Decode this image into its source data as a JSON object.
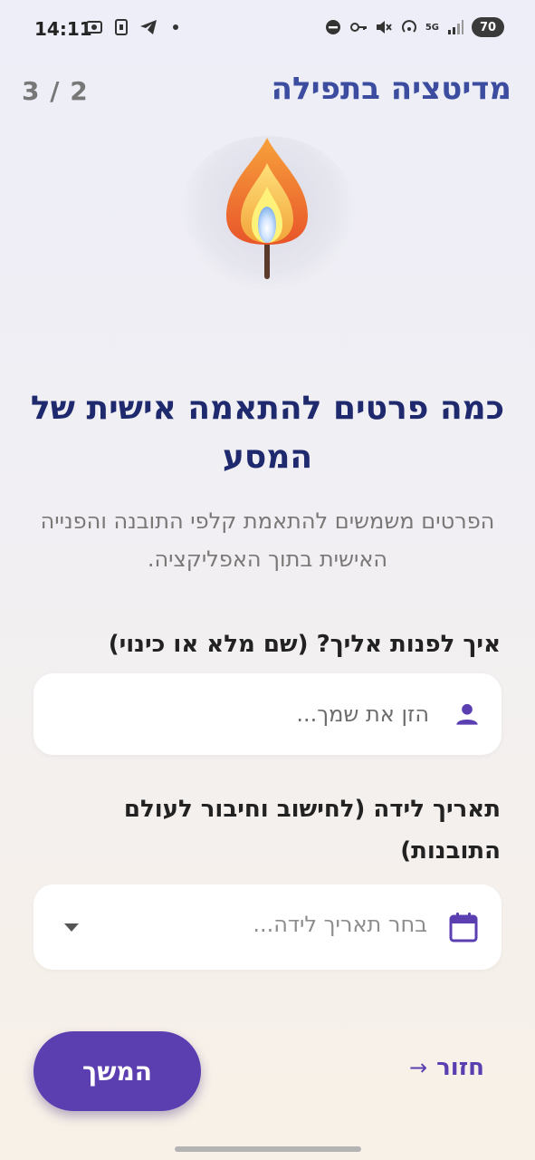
{
  "status_bar": {
    "time": "14:11",
    "network_label": "5G",
    "battery": "70"
  },
  "header": {
    "page_counter": "3 / 2",
    "title": "מדיטציה בתפילה"
  },
  "main": {
    "heading": "כמה פרטים להתאמה אישית של המסע",
    "description": "הפרטים משמשים להתאמת קלפי התובנה והפנייה האישית בתוך האפליקציה."
  },
  "form": {
    "name_label": "איך לפנות אליך? (שם מלא או כינוי)",
    "name_placeholder": "הזן את שמך...",
    "name_value": "",
    "birthdate_label": "תאריך לידה (לחישוב וחיבור לעולם התובנות)",
    "birthdate_placeholder": "בחר תאריך לידה..."
  },
  "actions": {
    "continue_label": "המשך",
    "back_label": "חזור",
    "back_arrow": "→"
  },
  "icons": {
    "person": "person-icon",
    "calendar": "calendar-icon",
    "candle": "candle-icon",
    "dropdown": "chevron-down-icon"
  },
  "colors": {
    "primary": "#5b3fb0",
    "title": "#3c4da0",
    "heading": "#1f2a6e"
  }
}
